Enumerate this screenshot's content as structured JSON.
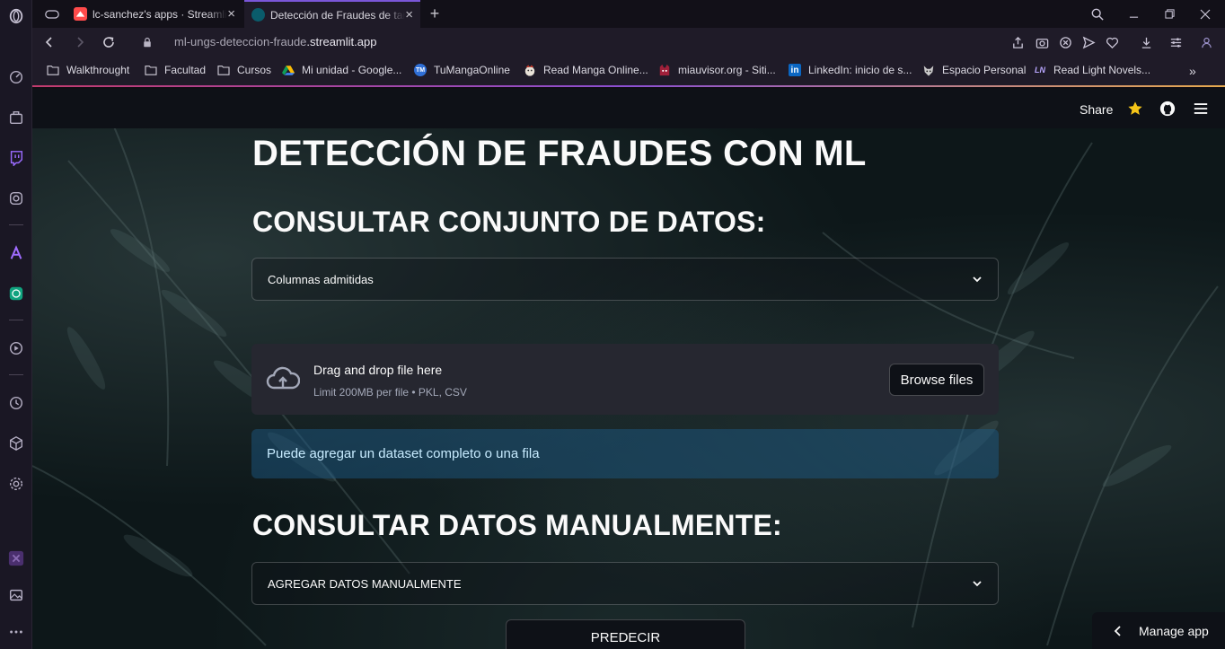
{
  "browser": {
    "tabs": [
      {
        "title": "lc-sanchez's apps · Streamlit",
        "active": false
      },
      {
        "title": "Detección de Fraudes de tarjetas",
        "active": true
      }
    ],
    "new_tab_label": "+",
    "url": {
      "prefix": "ml-ungs-deteccion-fraude",
      "domain": ".streamlit.app"
    },
    "bookmarks": [
      {
        "label": "Walkthrought",
        "icon": "folder-icon"
      },
      {
        "label": "Facultad",
        "icon": "folder-icon"
      },
      {
        "label": "Cursos",
        "icon": "folder-icon"
      },
      {
        "label": "Mi unidad - Google...",
        "icon": "google-drive-icon"
      },
      {
        "label": "TuMangaOnline",
        "icon": "tmo-icon"
      },
      {
        "label": "Read Manga Online...",
        "icon": "manga-icon"
      },
      {
        "label": "miauvisor.org - Siti...",
        "icon": "miauvisor-icon"
      },
      {
        "label": "LinkedIn: inicio de s...",
        "icon": "linkedin-icon"
      },
      {
        "label": "Espacio Personal",
        "icon": "wolf-icon"
      },
      {
        "label": "Read Light Novels...",
        "icon": "ln-icon"
      }
    ],
    "bookmarks_overflow": "»",
    "linkedin_glyph": "in",
    "ln_glyph": "LN",
    "tmo_glyph": "TM"
  },
  "streamlit": {
    "share_label": "Share",
    "title": "DETECCIÓN DE FRAUDES CON ML",
    "section_dataset": "CONSULTAR CONJUNTO DE DATOS:",
    "expander_columns": "Columnas admitidas",
    "uploader": {
      "title": "Drag and drop file here",
      "limit": "Limit 200MB per file • PKL, CSV",
      "browse_label": "Browse files"
    },
    "info_text": "Puede agregar un dataset completo o una fila",
    "section_manual": "CONSULTAR DATOS MANUALMENTE:",
    "expander_manual": "AGREGAR DATOS MANUALMENTE",
    "predict_label": "PREDECIR",
    "manage_label": "Manage app"
  },
  "colors": {
    "accent_purple": "#7a56d8",
    "streamlit_dark": "#0e1117",
    "info_blue": "#1c5e8c",
    "star_yellow": "#f5c518"
  }
}
